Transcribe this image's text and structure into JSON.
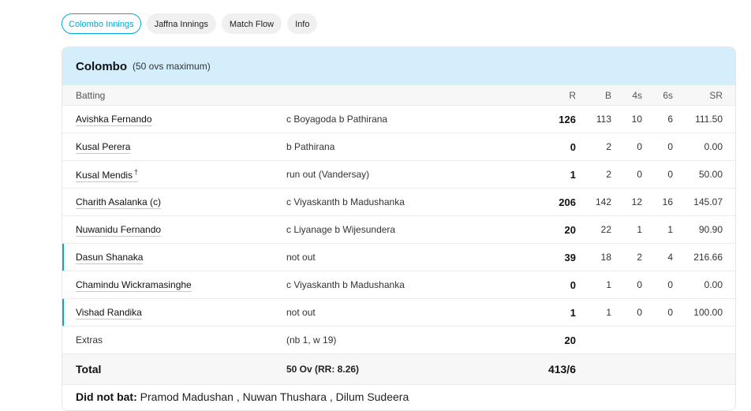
{
  "tabs": [
    {
      "label": "Colombo Innings",
      "active": true
    },
    {
      "label": "Jaffna Innings",
      "active": false
    },
    {
      "label": "Match Flow",
      "active": false
    },
    {
      "label": "Info",
      "active": false
    }
  ],
  "innings": {
    "team": "Colombo",
    "overs_note": "(50 ovs maximum)",
    "headers": {
      "batting": "Batting",
      "r": "R",
      "b": "B",
      "fours": "4s",
      "sixes": "6s",
      "sr": "SR"
    },
    "batters": [
      {
        "name": "Avishka Fernando",
        "dismissal": "c Boyagoda b Pathirana",
        "r": "126",
        "b": "113",
        "fours": "10",
        "sixes": "6",
        "sr": "111.50"
      },
      {
        "name": "Kusal Perera",
        "dismissal": "b Pathirana",
        "r": "0",
        "b": "2",
        "fours": "0",
        "sixes": "0",
        "sr": "0.00"
      },
      {
        "name": "Kusal Mendis",
        "keeper_mark": "†",
        "dismissal": "run out (Vandersay)",
        "r": "1",
        "b": "2",
        "fours": "0",
        "sixes": "0",
        "sr": "50.00"
      },
      {
        "name": "Charith Asalanka (c)",
        "dismissal": "c Viyaskanth b Madushanka",
        "r": "206",
        "b": "142",
        "fours": "12",
        "sixes": "16",
        "sr": "145.07"
      },
      {
        "name": "Nuwanidu Fernando",
        "dismissal": "c Liyanage b Wijesundera",
        "r": "20",
        "b": "22",
        "fours": "1",
        "sixes": "1",
        "sr": "90.90"
      },
      {
        "name": "Dasun Shanaka",
        "dismissal": "not out",
        "r": "39",
        "b": "18",
        "fours": "2",
        "sixes": "4",
        "sr": "216.66"
      },
      {
        "name": "Chamindu Wickramasinghe",
        "dismissal": "c Viyaskanth b Madushanka",
        "r": "0",
        "b": "1",
        "fours": "0",
        "sixes": "0",
        "sr": "0.00"
      },
      {
        "name": "Vishad Randika",
        "dismissal": "not out",
        "r": "1",
        "b": "1",
        "fours": "0",
        "sixes": "0",
        "sr": "100.00"
      }
    ],
    "extras": {
      "label": "Extras",
      "detail": "(nb 1, w 19)",
      "runs": "20"
    },
    "total": {
      "label": "Total",
      "overs": "50 Ov (RR: 8.26)",
      "score": "413/6"
    },
    "did_not_bat": {
      "label": "Did not bat:",
      "players": "Pramod Madushan , Nuwan Thushara , Dilum Sudeera"
    }
  },
  "colors": {
    "accent": "#03a9d8",
    "header_bg": "#d4eefc"
  }
}
